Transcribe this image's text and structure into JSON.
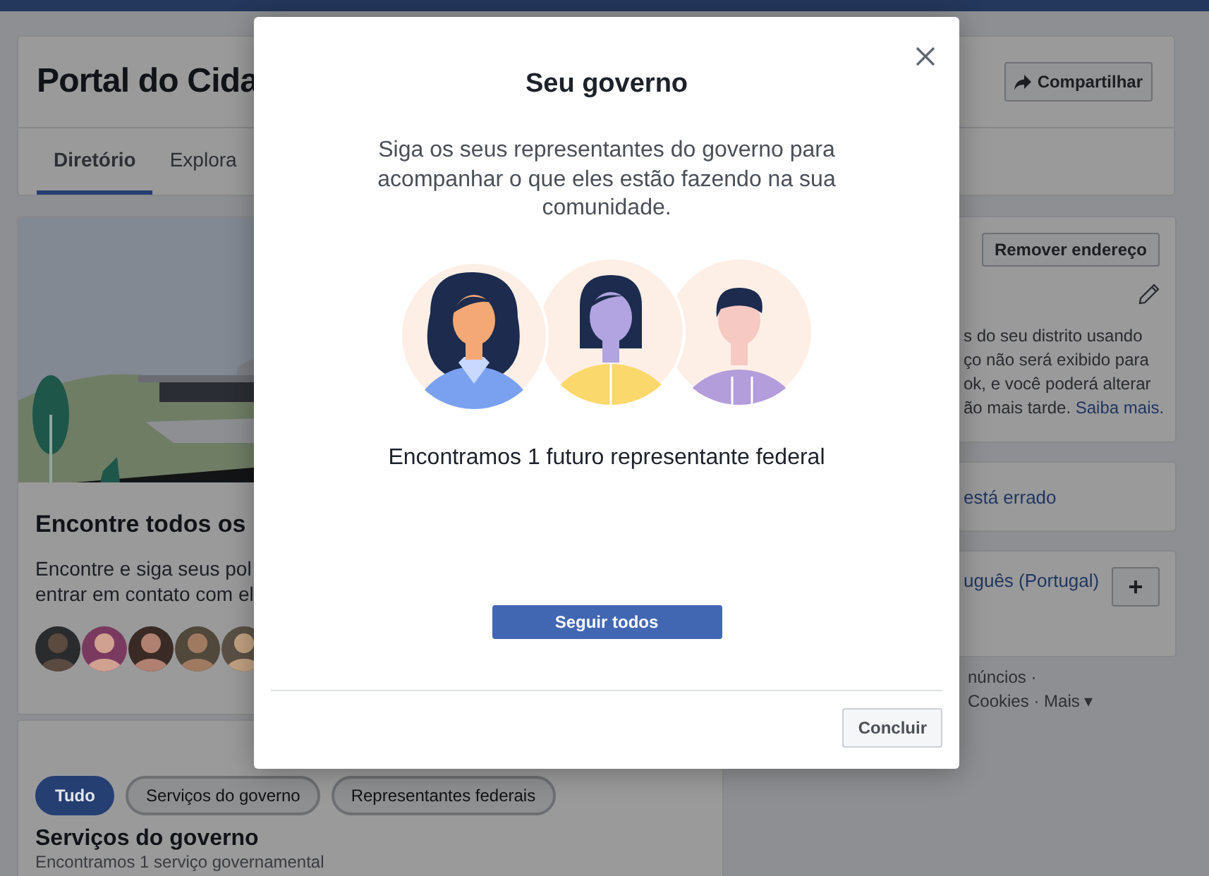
{
  "page": {
    "title": "Portal do Cida",
    "share_button": "Compartilhar",
    "tabs": [
      {
        "label": "Diretório",
        "selected": true
      },
      {
        "label": "Explora",
        "selected": false
      }
    ]
  },
  "intro_card": {
    "heading": "Encontre todos os",
    "lines": [
      "Encontre e siga seus pol",
      "entrar em contato com el"
    ]
  },
  "filters": [
    {
      "label": "Tudo",
      "selected": true
    },
    {
      "label": "Serviços do governo",
      "selected": false
    },
    {
      "label": "Representantes federais",
      "selected": false
    }
  ],
  "services": {
    "heading": "Serviços do governo",
    "subtitle": "Encontramos 1 serviço governamental"
  },
  "address_card": {
    "remove_button": "Remover endereço",
    "lines": [
      "s do seu distrito usando",
      "ço não será exibido para",
      "ok, e você poderá alterar",
      "ão mais tarde."
    ],
    "link": "Saiba mais."
  },
  "wrong_address_link": "está errado",
  "language_card": {
    "link": "uguês (Portugal)",
    "add_button": "+"
  },
  "footer": [
    "núncios ·",
    "Cookies · Mais ▾"
  ],
  "dialog": {
    "title": "Seu governo",
    "description": "Siga os seus representantes do governo para acompanhar o que eles estão fazendo na sua comunidade.",
    "result": "Encontramos 1 futuro representante federal",
    "follow_button": "Seguir todos",
    "done_button": "Concluir"
  }
}
